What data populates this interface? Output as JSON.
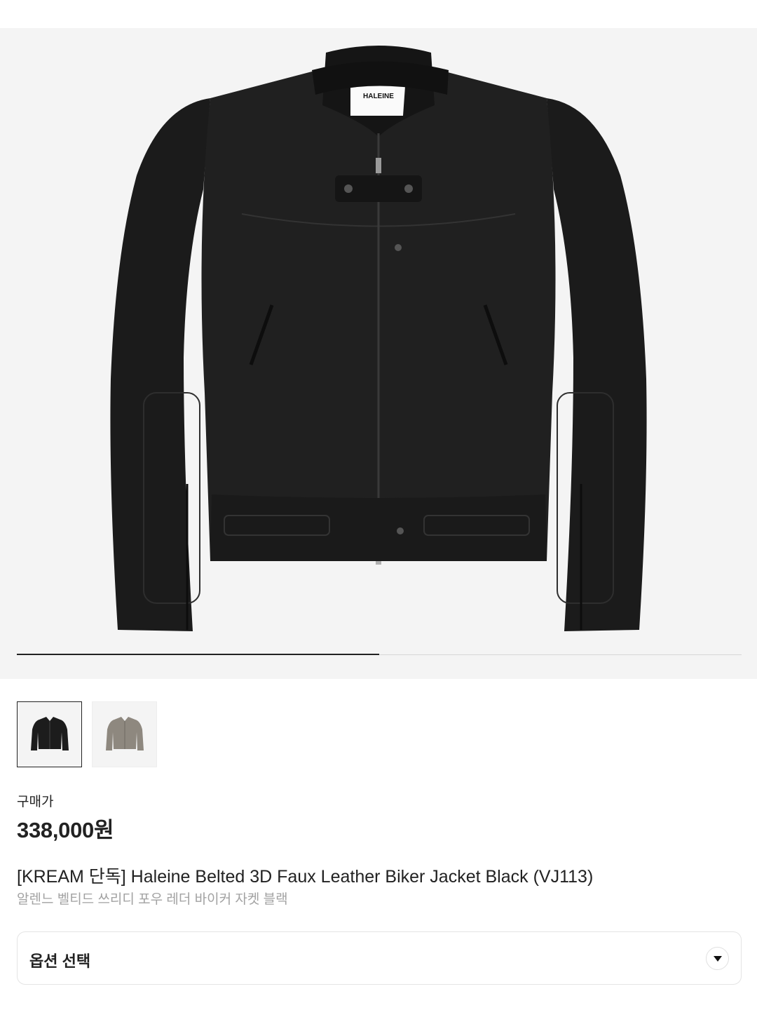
{
  "gallery": {
    "product_image_icon": "black-leather-jacket",
    "brand_tag": "HALEINE",
    "slide_progress_fraction": 0.5,
    "thumbnails": [
      {
        "icon": "black-jacket-thumbnail",
        "selected": true
      },
      {
        "icon": "gray-jacket-thumbnail",
        "selected": false
      }
    ]
  },
  "price": {
    "label": "구매가",
    "value": "338,000원"
  },
  "product": {
    "title": "[KREAM 단독] Haleine Belted 3D Faux Leather Biker Jacket Black (VJ113)",
    "subtitle": "알렌느 벨티드 쓰리디 포우 레더 바이커 자켓 블랙"
  },
  "option": {
    "label": "옵션 선택",
    "icon": "chevron-down-icon"
  },
  "colors": {
    "hero_bg": "#f4f4f4",
    "text_primary": "#222222",
    "text_secondary": "#a2a2a2"
  }
}
